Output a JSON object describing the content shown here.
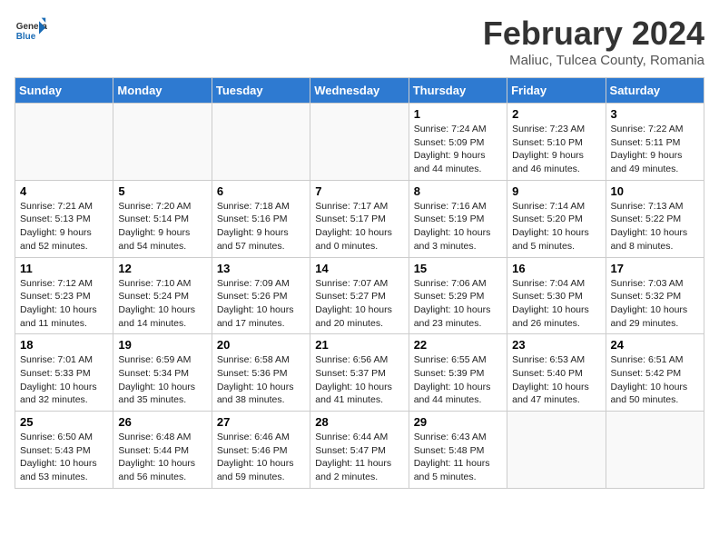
{
  "header": {
    "logo_line1": "General",
    "logo_line2": "Blue",
    "month_title": "February 2024",
    "location": "Maliuc, Tulcea County, Romania"
  },
  "weekdays": [
    "Sunday",
    "Monday",
    "Tuesday",
    "Wednesday",
    "Thursday",
    "Friday",
    "Saturday"
  ],
  "weeks": [
    [
      {
        "day": "",
        "info": ""
      },
      {
        "day": "",
        "info": ""
      },
      {
        "day": "",
        "info": ""
      },
      {
        "day": "",
        "info": ""
      },
      {
        "day": "1",
        "info": "Sunrise: 7:24 AM\nSunset: 5:09 PM\nDaylight: 9 hours\nand 44 minutes."
      },
      {
        "day": "2",
        "info": "Sunrise: 7:23 AM\nSunset: 5:10 PM\nDaylight: 9 hours\nand 46 minutes."
      },
      {
        "day": "3",
        "info": "Sunrise: 7:22 AM\nSunset: 5:11 PM\nDaylight: 9 hours\nand 49 minutes."
      }
    ],
    [
      {
        "day": "4",
        "info": "Sunrise: 7:21 AM\nSunset: 5:13 PM\nDaylight: 9 hours\nand 52 minutes."
      },
      {
        "day": "5",
        "info": "Sunrise: 7:20 AM\nSunset: 5:14 PM\nDaylight: 9 hours\nand 54 minutes."
      },
      {
        "day": "6",
        "info": "Sunrise: 7:18 AM\nSunset: 5:16 PM\nDaylight: 9 hours\nand 57 minutes."
      },
      {
        "day": "7",
        "info": "Sunrise: 7:17 AM\nSunset: 5:17 PM\nDaylight: 10 hours\nand 0 minutes."
      },
      {
        "day": "8",
        "info": "Sunrise: 7:16 AM\nSunset: 5:19 PM\nDaylight: 10 hours\nand 3 minutes."
      },
      {
        "day": "9",
        "info": "Sunrise: 7:14 AM\nSunset: 5:20 PM\nDaylight: 10 hours\nand 5 minutes."
      },
      {
        "day": "10",
        "info": "Sunrise: 7:13 AM\nSunset: 5:22 PM\nDaylight: 10 hours\nand 8 minutes."
      }
    ],
    [
      {
        "day": "11",
        "info": "Sunrise: 7:12 AM\nSunset: 5:23 PM\nDaylight: 10 hours\nand 11 minutes."
      },
      {
        "day": "12",
        "info": "Sunrise: 7:10 AM\nSunset: 5:24 PM\nDaylight: 10 hours\nand 14 minutes."
      },
      {
        "day": "13",
        "info": "Sunrise: 7:09 AM\nSunset: 5:26 PM\nDaylight: 10 hours\nand 17 minutes."
      },
      {
        "day": "14",
        "info": "Sunrise: 7:07 AM\nSunset: 5:27 PM\nDaylight: 10 hours\nand 20 minutes."
      },
      {
        "day": "15",
        "info": "Sunrise: 7:06 AM\nSunset: 5:29 PM\nDaylight: 10 hours\nand 23 minutes."
      },
      {
        "day": "16",
        "info": "Sunrise: 7:04 AM\nSunset: 5:30 PM\nDaylight: 10 hours\nand 26 minutes."
      },
      {
        "day": "17",
        "info": "Sunrise: 7:03 AM\nSunset: 5:32 PM\nDaylight: 10 hours\nand 29 minutes."
      }
    ],
    [
      {
        "day": "18",
        "info": "Sunrise: 7:01 AM\nSunset: 5:33 PM\nDaylight: 10 hours\nand 32 minutes."
      },
      {
        "day": "19",
        "info": "Sunrise: 6:59 AM\nSunset: 5:34 PM\nDaylight: 10 hours\nand 35 minutes."
      },
      {
        "day": "20",
        "info": "Sunrise: 6:58 AM\nSunset: 5:36 PM\nDaylight: 10 hours\nand 38 minutes."
      },
      {
        "day": "21",
        "info": "Sunrise: 6:56 AM\nSunset: 5:37 PM\nDaylight: 10 hours\nand 41 minutes."
      },
      {
        "day": "22",
        "info": "Sunrise: 6:55 AM\nSunset: 5:39 PM\nDaylight: 10 hours\nand 44 minutes."
      },
      {
        "day": "23",
        "info": "Sunrise: 6:53 AM\nSunset: 5:40 PM\nDaylight: 10 hours\nand 47 minutes."
      },
      {
        "day": "24",
        "info": "Sunrise: 6:51 AM\nSunset: 5:42 PM\nDaylight: 10 hours\nand 50 minutes."
      }
    ],
    [
      {
        "day": "25",
        "info": "Sunrise: 6:50 AM\nSunset: 5:43 PM\nDaylight: 10 hours\nand 53 minutes."
      },
      {
        "day": "26",
        "info": "Sunrise: 6:48 AM\nSunset: 5:44 PM\nDaylight: 10 hours\nand 56 minutes."
      },
      {
        "day": "27",
        "info": "Sunrise: 6:46 AM\nSunset: 5:46 PM\nDaylight: 10 hours\nand 59 minutes."
      },
      {
        "day": "28",
        "info": "Sunrise: 6:44 AM\nSunset: 5:47 PM\nDaylight: 11 hours\nand 2 minutes."
      },
      {
        "day": "29",
        "info": "Sunrise: 6:43 AM\nSunset: 5:48 PM\nDaylight: 11 hours\nand 5 minutes."
      },
      {
        "day": "",
        "info": ""
      },
      {
        "day": "",
        "info": ""
      }
    ]
  ]
}
